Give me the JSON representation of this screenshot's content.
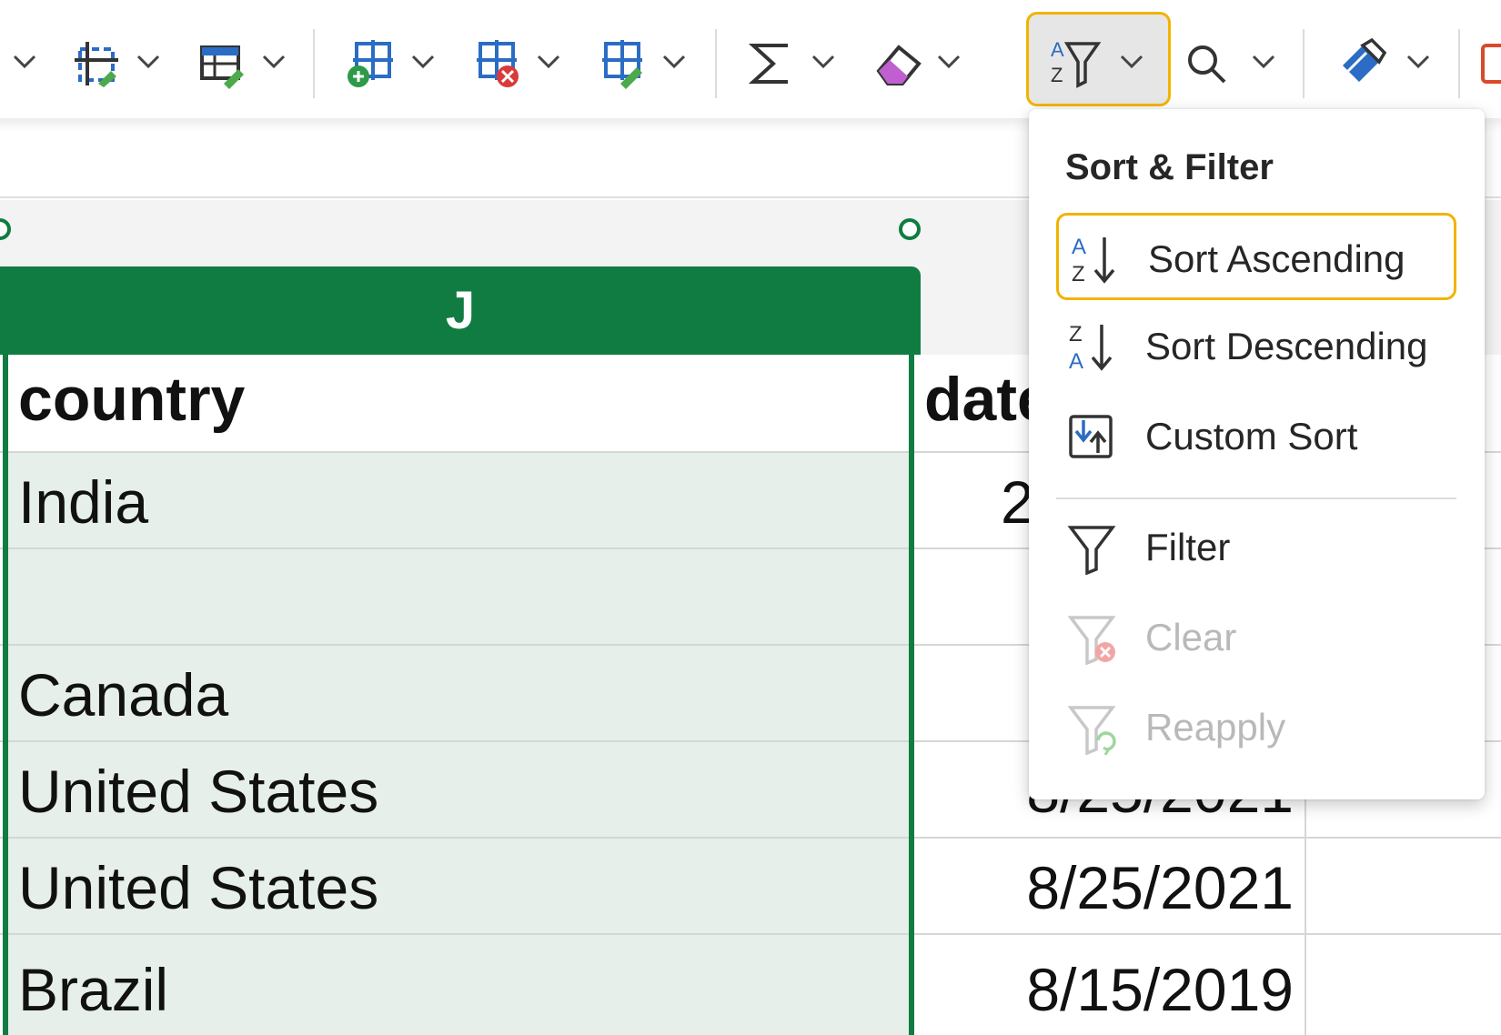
{
  "ribbon": {
    "buttons": [
      {
        "name": "format-as-table",
        "icon": "table-format-icon"
      },
      {
        "name": "insert-cells",
        "icon": "insert-cells-icon"
      },
      {
        "name": "delete-cells",
        "icon": "delete-cells-icon"
      },
      {
        "name": "format-cells",
        "icon": "format-cells-icon"
      },
      {
        "name": "autosum",
        "icon": "sigma-icon"
      },
      {
        "name": "clear",
        "icon": "eraser-icon"
      },
      {
        "name": "sort-filter",
        "icon": "sort-filter-icon"
      },
      {
        "name": "find-select",
        "icon": "magnifier-icon"
      },
      {
        "name": "analyze",
        "icon": "brush-icon"
      }
    ]
  },
  "column": {
    "letter": "J"
  },
  "grid": {
    "header": {
      "country": "country",
      "date": "date"
    },
    "rows": [
      {
        "country": "India",
        "date": "2"
      },
      {
        "country": "",
        "date": ""
      },
      {
        "country": "Canada",
        "date": ""
      },
      {
        "country": "United States",
        "date": "8/25/2021"
      },
      {
        "country": "United States",
        "date": "8/25/2021"
      },
      {
        "country": "Brazil",
        "date": "8/15/2019"
      }
    ]
  },
  "menu": {
    "title": "Sort & Filter",
    "items": [
      {
        "label": "Sort Ascending",
        "icon": "sort-ascending-icon",
        "enabled": true,
        "highlighted": true
      },
      {
        "label": "Sort Descending",
        "icon": "sort-descending-icon",
        "enabled": true
      },
      {
        "label": "Custom Sort",
        "icon": "custom-sort-icon",
        "enabled": true
      },
      {
        "label": "Filter",
        "icon": "filter-icon",
        "enabled": true
      },
      {
        "label": "Clear",
        "icon": "clear-filter-icon",
        "enabled": false
      },
      {
        "label": "Reapply",
        "icon": "reapply-filter-icon",
        "enabled": false
      }
    ]
  },
  "colors": {
    "accent_green": "#107c41",
    "highlight_yellow": "#f2b300",
    "selection_fill": "#e6efe9"
  }
}
